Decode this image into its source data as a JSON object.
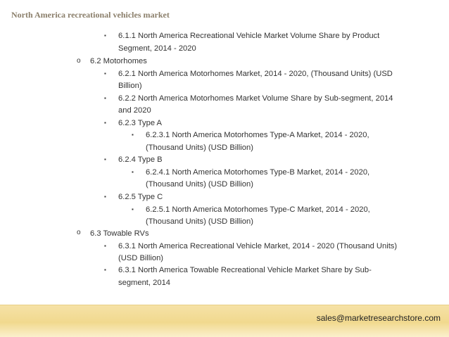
{
  "header": {
    "title": "North America recreational vehicles market"
  },
  "toc": {
    "item_611": "6.1.1 North America Recreational Vehicle Market Volume Share by Product",
    "item_611_cont": "Segment, 2014 - 2020",
    "item_62": "6.2 Motorhomes",
    "item_621": "6.2.1 North America Motorhomes Market, 2014 - 2020, (Thousand Units) (USD",
    "item_621_cont": "Billion)",
    "item_622": "6.2.2 North America Motorhomes Market Volume Share by Sub-segment, 2014",
    "item_622_cont": "and 2020",
    "item_623": "6.2.3 Type A",
    "item_6231": "6.2.3.1 North America Motorhomes Type-A Market, 2014 - 2020,",
    "item_6231_cont": "(Thousand Units) (USD Billion)",
    "item_624": "6.2.4 Type B",
    "item_6241": "6.2.4.1 North America Motorhomes Type-B Market, 2014 - 2020,",
    "item_6241_cont": "(Thousand Units) (USD Billion)",
    "item_625": "6.2.5 Type C",
    "item_6251": "6.2.5.1 North America Motorhomes Type-C Market, 2014 - 2020,",
    "item_6251_cont": "(Thousand Units) (USD Billion)",
    "item_63": "6.3 Towable RVs",
    "item_631a": "6.3.1 North America Recreational Vehicle Market, 2014 - 2020 (Thousand Units)",
    "item_631a_cont": "(USD Billion)",
    "item_631b": "6.3.1 North America Towable Recreational Vehicle Market Share by Sub-",
    "item_631b_cont": "segment, 2014"
  },
  "bullets": {
    "level2": "o",
    "level3": "▪"
  },
  "footer": {
    "email": "sales@marketresearchstore.com"
  }
}
